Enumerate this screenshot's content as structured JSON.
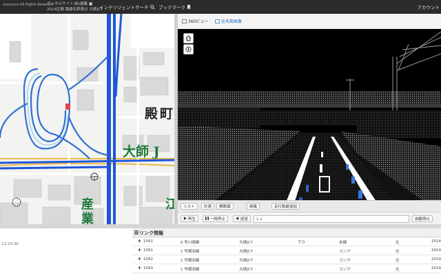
{
  "header": {
    "brand_line1": "xxxxxxxx All Rights Reserved",
    "title_line1": "ポータルサイト(仮)編集 ■",
    "title_line2": "2014区間 路線名称表示 大師JCT",
    "menu": [
      {
        "label": "インテリジェントサーチ",
        "icon": "search-icon"
      },
      {
        "label": "ブックマーク",
        "icon": "bookmark-icon"
      }
    ],
    "account": "アカウント"
  },
  "map": {
    "labels": {
      "dono": "殿",
      "machi": "町",
      "daishi_j": "大師 J",
      "san": "産",
      "gyo": "業",
      "e": "江"
    },
    "colors": {
      "expressway": "#1e56d8",
      "route": "#3d7fd6",
      "label": "#1c7a3a"
    }
  },
  "viewer": {
    "tabs": [
      {
        "label": "360ビュー",
        "icon": "panorama-icon",
        "active": false
      },
      {
        "label": "全天周画像",
        "icon": "sphere-icon",
        "active": true
      }
    ],
    "controls": [
      "home-icon",
      "compass-icon"
    ]
  },
  "toolbar": {
    "row1": [
      "リスト",
      "計測",
      "横断図",
      "画像",
      "走行軌跡追加"
    ],
    "row2": {
      "play": "再生",
      "pause": "一時停止",
      "back": "逆送",
      "input_value": "1 x",
      "auto": "自動停止"
    }
  },
  "left_panel": {
    "timestamp": "12:23:30"
  },
  "link_panel": {
    "title": "リンク情報",
    "rows": [
      {
        "id": "1091",
        "name": "6 号川崎線",
        "jct": "大師JCT",
        "dir": "下り",
        "type": "本線",
        "side": "左",
        "year": "2014"
      },
      {
        "id": "1091",
        "name": "1 号横羽線",
        "jct": "大師JCT",
        "dir": "",
        "type": "ランプ",
        "side": "左",
        "year": "2014"
      },
      {
        "id": "1092",
        "name": "1 号横羽線",
        "jct": "大師JCT",
        "dir": "",
        "type": "ランプ",
        "side": "左",
        "year": "2014"
      },
      {
        "id": "1093",
        "name": "1 号横羽線",
        "jct": "大師JCT",
        "dir": "",
        "type": "ランプ",
        "side": "左",
        "year": "2014"
      }
    ]
  }
}
